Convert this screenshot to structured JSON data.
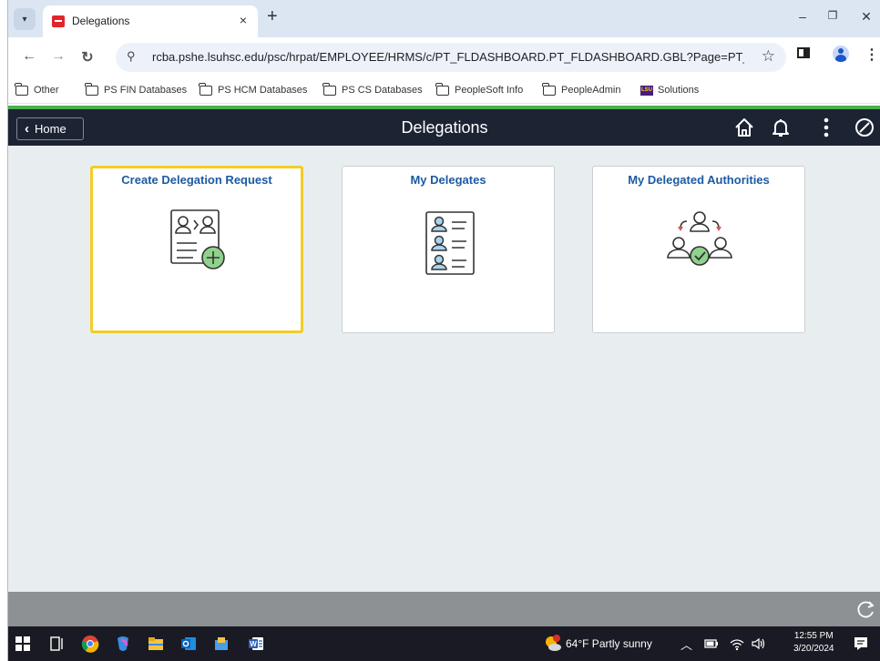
{
  "browser": {
    "tab_title": "Delegations",
    "tab_close": "×",
    "new_tab": "+",
    "url": "rcba.pshe.lsuhsc.edu/psc/hrpat/EMPLOYEE/HRMS/c/PT_FLDASHBOARD.PT_FLDASHBOARD.GBL?Page=PT_LANDI...",
    "bookmarks": [
      {
        "label": "Other",
        "icon": "folder-icon"
      },
      {
        "label": "PS FIN Databases",
        "icon": "folder-icon"
      },
      {
        "label": "PS HCM Databases",
        "icon": "folder-icon"
      },
      {
        "label": "PS CS Databases",
        "icon": "folder-icon"
      },
      {
        "label": "PeopleSoft Info",
        "icon": "folder-icon"
      },
      {
        "label": "PeopleAdmin",
        "icon": "folder-icon"
      },
      {
        "label": "Solutions",
        "icon": "lsu-logo-icon"
      }
    ]
  },
  "header": {
    "home_label": "Home",
    "title": "Delegations"
  },
  "tiles": [
    {
      "title": "Create Delegation Request",
      "icon": "create-delegation-icon",
      "selected": true
    },
    {
      "title": "My Delegates",
      "icon": "delegates-list-icon",
      "selected": false
    },
    {
      "title": "My Delegated Authorities",
      "icon": "delegated-authorities-icon",
      "selected": false
    }
  ],
  "taskbar": {
    "weather": "64°F  Partly sunny",
    "time": "12:55 PM",
    "date": "3/20/2024"
  },
  "colors": {
    "header_bg": "#1c2434",
    "main_bg": "#e8eef0",
    "tile_title": "#1c5aa3",
    "selected_border": "#f2cd25",
    "accent_green": "#4caf50"
  }
}
